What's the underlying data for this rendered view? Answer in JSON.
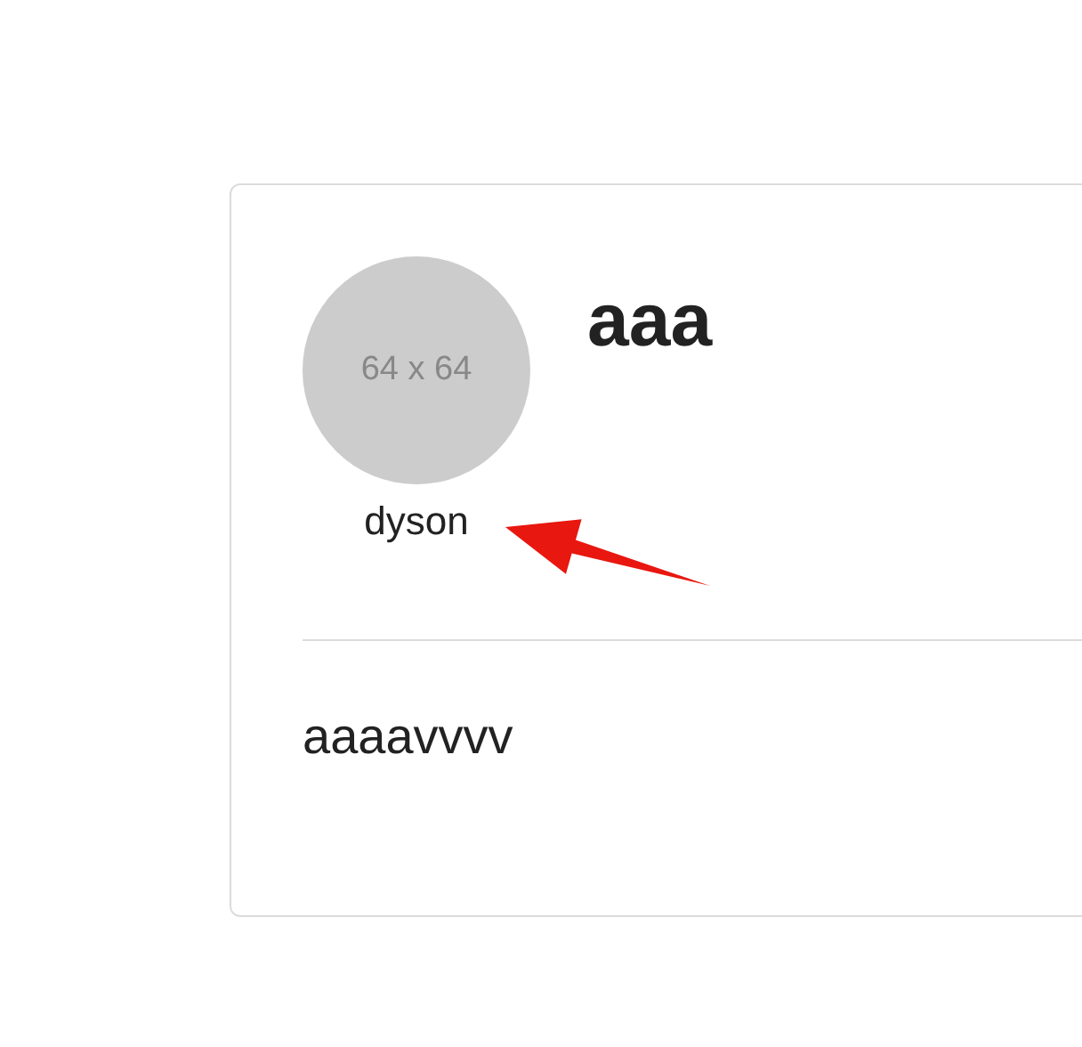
{
  "card": {
    "avatar": {
      "placeholder_text": "64 x 64",
      "caption": "dyson"
    },
    "title": "aaa",
    "body": "aaaavvvv"
  }
}
